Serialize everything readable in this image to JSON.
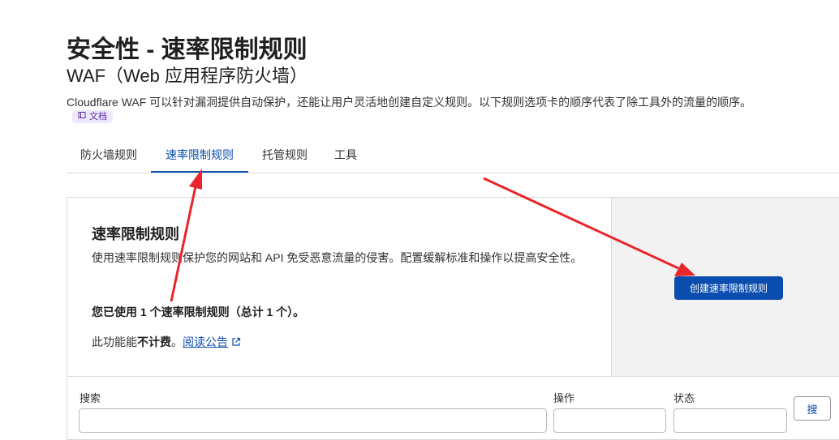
{
  "header": {
    "title": "安全性 - 速率限制规则",
    "subtitle": "WAF（Web 应用程序防火墙）",
    "description": "Cloudflare WAF 可以针对漏洞提供自动保护，还能让用户灵活地创建自定义规则。以下规则选项卡的顺序代表了除工具外的流量的顺序。",
    "docs_label": "文档"
  },
  "tabs": [
    {
      "label": "防火墙规则",
      "active": false
    },
    {
      "label": "速率限制规则",
      "active": true
    },
    {
      "label": "托管规则",
      "active": false
    },
    {
      "label": "工具",
      "active": false
    }
  ],
  "card": {
    "title": "速率限制规则",
    "description": "使用速率限制规则保护您的网站和 API 免受恶意流量的侵害。配置缓解标准和操作以提高安全性。",
    "usage": "您已使用 1 个速率限制规则（总计 1 个）。",
    "billing_prefix": "此功能能",
    "billing_bold": "不计费",
    "billing_sep": "。",
    "billing_link": "阅读公告",
    "create_button": "创建速率限制规则"
  },
  "filters": {
    "search_label": "搜索",
    "action_label": "操作",
    "status_label": "状态",
    "search_button": "搜"
  },
  "colors": {
    "accent": "#0b4dae",
    "annotation_arrow": "#e8262b",
    "panel_gray": "#f2f2f2"
  },
  "icons": [
    "book-icon",
    "external-link-icon"
  ]
}
